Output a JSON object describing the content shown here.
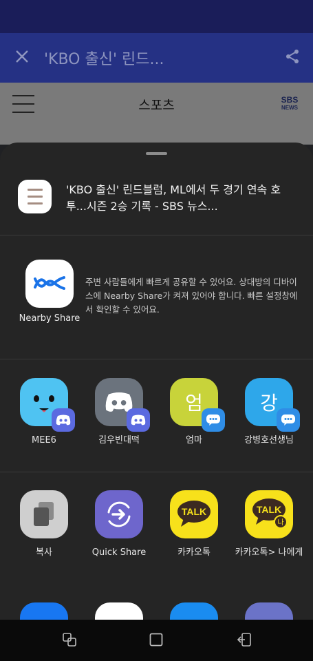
{
  "browser": {
    "title": "'KBO 출신' 린드..."
  },
  "site": {
    "section": "스포츠",
    "logo_line1": "SBS",
    "logo_line2": "NEWS"
  },
  "share_sheet": {
    "preview_title": "'KBO 출신' 린드블럼, ML에서 두 경기 연속 호투...시즌 2승 기록 - SBS 뉴스...",
    "nearby": {
      "label": "Nearby Share",
      "description": "주변 사람들에게 빠르게 공유할 수 있어요. 상대방의 디바이스에 Nearby Share가 켜져 있어야 합니다. 빠른 설정창에서 확인할 수 있어요."
    },
    "direct_targets": [
      {
        "label": "MEE6",
        "icon": "mee6-icon",
        "badge": "discord-icon"
      },
      {
        "label": "김우빈대떡",
        "icon": "discord-icon",
        "badge": "discord-icon"
      },
      {
        "label": "엄마",
        "icon": "contact-icon",
        "letter": "엄",
        "color": "#c8d33a",
        "badge": "kakaotalk-message-icon"
      },
      {
        "label": "강병호선생님",
        "icon": "contact-icon",
        "letter": "강",
        "color": "#2ea7ea",
        "badge": "kakaotalk-message-icon"
      }
    ],
    "apps": [
      {
        "label": "복사",
        "icon": "copy-icon"
      },
      {
        "label": "Quick Share",
        "icon": "quick-share-icon"
      },
      {
        "label": "카카오톡",
        "icon": "kakaotalk-icon",
        "talk_text": "TALK"
      },
      {
        "label": "카카오톡> 나에게",
        "icon": "kakaotalk-me-icon",
        "talk_text": "TALK",
        "me_text": "나"
      }
    ]
  },
  "colors": {
    "status_bar": "#1a1d59",
    "toolbar": "#253184",
    "sheet_bg": "#252525",
    "kakao_yellow": "#f7e11b"
  }
}
